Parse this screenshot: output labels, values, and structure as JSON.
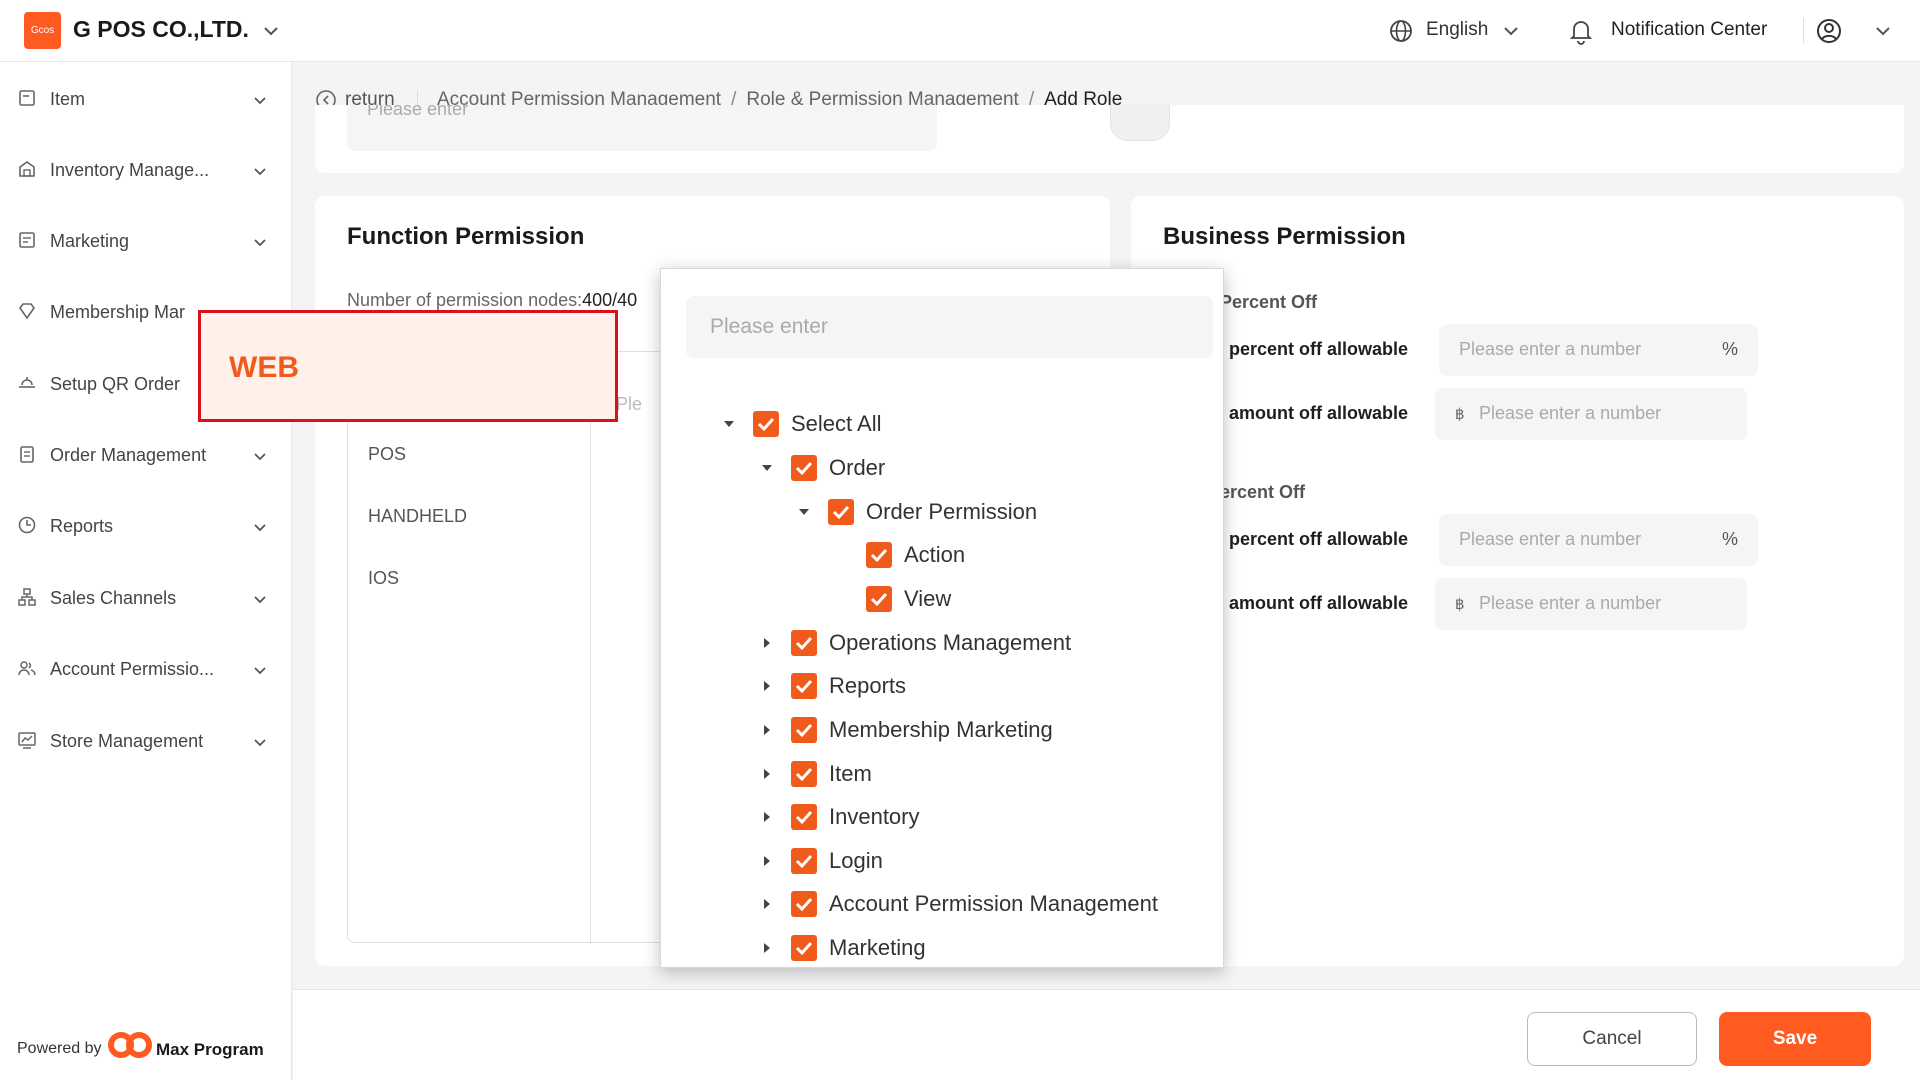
{
  "header": {
    "logo_text": "Gcos",
    "company": "G POS CO.,LTD.",
    "language": "English",
    "notification": "Notification Center"
  },
  "sidebar": {
    "items": [
      {
        "label": "Item",
        "icon": "item-icon"
      },
      {
        "label": "Inventory Manage...",
        "icon": "warehouse-icon"
      },
      {
        "label": "Marketing",
        "icon": "marketing-icon"
      },
      {
        "label": "Membership Mar",
        "icon": "diamond-icon"
      },
      {
        "label": "Setup QR Order",
        "icon": "qr-order-icon"
      },
      {
        "label": "Order Management",
        "icon": "clipboard-icon"
      },
      {
        "label": "Reports",
        "icon": "clock-chart-icon"
      },
      {
        "label": "Sales Channels",
        "icon": "channels-icon"
      },
      {
        "label": "Account Permissio...",
        "icon": "users-icon"
      },
      {
        "label": "Store Management",
        "icon": "store-chart-icon"
      }
    ],
    "powered_by": "Powered by",
    "brand": "Max Program"
  },
  "breadcrumb": {
    "return_label": "return",
    "items": [
      "Account Permission Management",
      "Role & Permission Management",
      "Add Role"
    ]
  },
  "top_panel": {
    "input_placeholder": "Please enter"
  },
  "function_permission": {
    "title": "Function Permission",
    "nodes_label": "Number of permission nodes:",
    "nodes_value": "400/40",
    "platforms": [
      "POS",
      "HANDHELD",
      "IOS"
    ],
    "search_placeholder": "Ple",
    "selected_platform": "WEB"
  },
  "tree_popup": {
    "search_placeholder": "Please enter",
    "nodes": [
      {
        "label": "Select All",
        "expanded": true,
        "checked": true
      },
      {
        "label": "Order",
        "expanded": true,
        "checked": true
      },
      {
        "label": "Order Permission",
        "expanded": true,
        "checked": true
      },
      {
        "label": "Action",
        "leaf": true,
        "checked": true
      },
      {
        "label": "View",
        "leaf": true,
        "checked": true
      },
      {
        "label": "Operations Management",
        "expanded": false,
        "checked": true
      },
      {
        "label": "Reports",
        "expanded": false,
        "checked": true
      },
      {
        "label": "Membership Marketing",
        "expanded": false,
        "checked": true
      },
      {
        "label": "Item",
        "expanded": false,
        "checked": true
      },
      {
        "label": "Inventory",
        "expanded": false,
        "checked": true
      },
      {
        "label": "Login",
        "expanded": false,
        "checked": true
      },
      {
        "label": "Account Permission Management",
        "expanded": false,
        "checked": true
      },
      {
        "label": "Marketing",
        "expanded": false,
        "checked": true
      }
    ]
  },
  "business_permission": {
    "title": "Business Permission",
    "sections": [
      {
        "subtitle": "Percent Off",
        "percent_label": "t percent off allowable",
        "percent_placeholder": "Please enter a number",
        "percent_unit": "%",
        "amount_label": "t amount off allowable",
        "amount_currency": "฿",
        "amount_placeholder": "Please enter a number"
      },
      {
        "subtitle": "ercent Off",
        "percent_label": "t percent off allowable",
        "percent_placeholder": "Please enter a number",
        "percent_unit": "%",
        "amount_label": "t amount off allowable",
        "amount_currency": "฿",
        "amount_placeholder": "Please enter a number"
      }
    ]
  },
  "footer": {
    "cancel": "Cancel",
    "save": "Save"
  },
  "colors": {
    "accent": "#ff5a1f",
    "highlight_border": "#d9111b"
  }
}
